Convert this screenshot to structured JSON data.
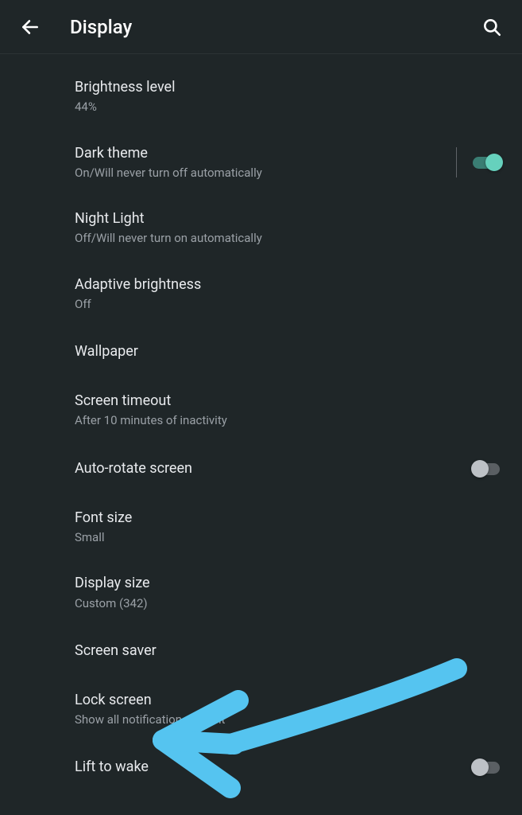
{
  "header": {
    "title": "Display"
  },
  "items": [
    {
      "title": "Brightness level",
      "subtitle": "44%",
      "control": "none"
    },
    {
      "title": "Dark theme",
      "subtitle": "On/Will never turn off automatically",
      "control": "switch",
      "switch_on": true,
      "divider": true
    },
    {
      "title": "Night Light",
      "subtitle": "Off/Will never turn on automatically",
      "control": "none"
    },
    {
      "title": "Adaptive brightness",
      "subtitle": "Off",
      "control": "none"
    },
    {
      "title": "Wallpaper",
      "subtitle": "",
      "control": "none"
    },
    {
      "title": "Screen timeout",
      "subtitle": "After 10 minutes of inactivity",
      "control": "none"
    },
    {
      "title": "Auto-rotate screen",
      "subtitle": "",
      "control": "switch",
      "switch_on": false,
      "divider": false
    },
    {
      "title": "Font size",
      "subtitle": "Small",
      "control": "none"
    },
    {
      "title": "Display size",
      "subtitle": "Custom (342)",
      "control": "none"
    },
    {
      "title": "Screen saver",
      "subtitle": "",
      "control": "none"
    },
    {
      "title": "Lock screen",
      "subtitle": "Show all notification content",
      "control": "none"
    },
    {
      "title": "Lift to wake",
      "subtitle": "",
      "control": "switch",
      "switch_on": false,
      "divider": false
    }
  ],
  "annotation": {
    "type": "arrow",
    "color": "#55c4f0"
  }
}
